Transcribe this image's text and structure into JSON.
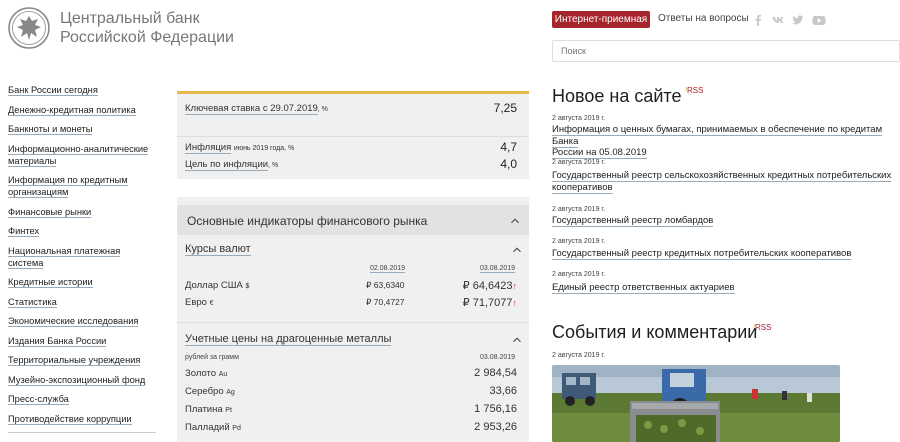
{
  "header": {
    "brand_line1": "Центральный банк",
    "brand_line2": "Российской Федерации",
    "reception_button": "Интернет-приемная",
    "faq_link": "Ответы на вопросы",
    "search_placeholder": "Поиск",
    "social_icons": [
      "facebook-icon",
      "vk-icon",
      "twitter-icon",
      "youtube-icon"
    ]
  },
  "nav": {
    "items": [
      "Банк России сегодня",
      "Денежно-кредитная политика",
      "Банкноты и монеты",
      "Информационно-аналитические материалы",
      "Информация по кредитным организациям",
      "Финансовые рынки",
      "Финтех",
      "Национальная платежная система",
      "Кредитные истории",
      "Статистика",
      "Экономические исследования",
      "Издания Банка России",
      "Территориальные учреждения",
      "Музейно-экспозиционный фонд",
      "Пресс-служба",
      "Противодействие коррупции"
    ]
  },
  "rates": {
    "key_rate_label": "Ключевая ставка с",
    "key_rate_date": "29.07.2019",
    "key_rate_unit": ", %",
    "key_rate_value": "7,25",
    "inflation_label": "Инфляция",
    "inflation_note": "июнь 2019 года, %",
    "inflation_value": "4,7",
    "target_label": "Цель по инфляции",
    "target_unit": ", %",
    "target_value": "4,0"
  },
  "indicators": {
    "title": "Основные индикаторы финансового рынка",
    "currency": {
      "title": "Курсы валют",
      "date1": "02.08.2019",
      "date2": "03.08.2019",
      "rows": [
        {
          "name": "Доллар США",
          "unit": "$",
          "v1": "₽ 63,6340",
          "v2": "₽ 64,6423",
          "trend": "↑"
        },
        {
          "name": "Евро",
          "unit": "€",
          "v1": "₽ 70,4727",
          "v2": "₽ 71,7077",
          "trend": "↑"
        }
      ]
    },
    "metals": {
      "title": "Учетные цены на драгоценные металлы",
      "unit_note": "рублей за грамм",
      "date": "03.08.2019",
      "rows": [
        {
          "name": "Золото",
          "sym": "Au",
          "value": "2 984,54"
        },
        {
          "name": "Серебро",
          "sym": "Ag",
          "value": "33,66"
        },
        {
          "name": "Платина",
          "sym": "Pt",
          "value": "1 756,16"
        },
        {
          "name": "Палладий",
          "sym": "Pd",
          "value": "2 953,26"
        }
      ]
    }
  },
  "news": {
    "title": "Новое на сайте",
    "rss": "RSS",
    "items": [
      {
        "date": "2 августа 2019 г.",
        "line1": "Информация о ценных бумагах, принимаемых в обеспечение по кредитам Банка",
        "line2": "России на 05.08.2019"
      },
      {
        "date": "2 августа 2019 г.",
        "line1": "Государственный реестр сельскохозяйственных кредитных потребительских",
        "line2": "кооперативов"
      },
      {
        "date": "2 августа 2019 г.",
        "line1": "Государственный реестр ломбардов",
        "line2": ""
      },
      {
        "date": "2 августа 2019 г.",
        "line1": "Государственный реестр кредитных потребительских кооперативов",
        "line2": ""
      },
      {
        "date": "2 августа 2019 г.",
        "line1": "Единый реестр ответственных актуариев",
        "line2": ""
      }
    ]
  },
  "events": {
    "title": "События и комментарии",
    "rss": "RSS",
    "date": "2 августа 2019 г."
  },
  "colors": {
    "accent": "#a6242c",
    "gold": "#e5b94e",
    "panel": "#f0f0f0"
  }
}
